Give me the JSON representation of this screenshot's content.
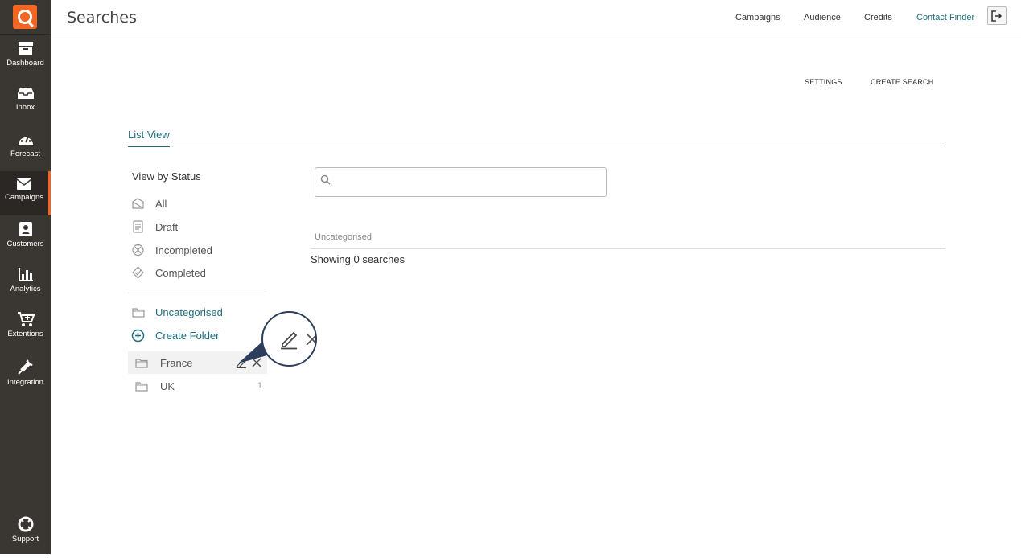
{
  "sidebar": {
    "items": [
      {
        "label": "Dashboard"
      },
      {
        "label": "Inbox"
      },
      {
        "label": "Forecast"
      },
      {
        "label": "Campaigns"
      },
      {
        "label": "Customers"
      },
      {
        "label": "Analytics"
      },
      {
        "label": "Extentions"
      },
      {
        "label": "Integration"
      }
    ],
    "support_label": "Support",
    "active_item": "Campaigns",
    "accent_color": "#f26522"
  },
  "header": {
    "title": "Searches",
    "links": [
      {
        "label": "Campaigns"
      },
      {
        "label": "Audience"
      },
      {
        "label": "Credits"
      },
      {
        "label": "Contact Finder"
      }
    ]
  },
  "actions": {
    "settings": "SETTINGS",
    "create_search": "CREATE SEARCH"
  },
  "tabs": {
    "list_view": "List View"
  },
  "status": {
    "heading": "View by Status",
    "items": [
      {
        "label": "All",
        "icon": "inbox-all-icon"
      },
      {
        "label": "Draft",
        "icon": "draft-icon"
      },
      {
        "label": "Incompleted",
        "icon": "incompleted-icon"
      },
      {
        "label": "Completed",
        "icon": "completed-icon"
      }
    ]
  },
  "folders": {
    "uncategorised": "Uncategorised",
    "create_folder": "Create Folder",
    "items": [
      {
        "name": "France"
      },
      {
        "name": "UK",
        "count": "1"
      }
    ]
  },
  "search": {
    "value": "",
    "placeholder": ""
  },
  "results": {
    "category": "Uncategorised",
    "showing": "Showing 0 searches"
  },
  "colors": {
    "teal": "#1d6f7d",
    "sidebar_bg": "#3a3632",
    "callout_border": "#2d3e5c"
  }
}
